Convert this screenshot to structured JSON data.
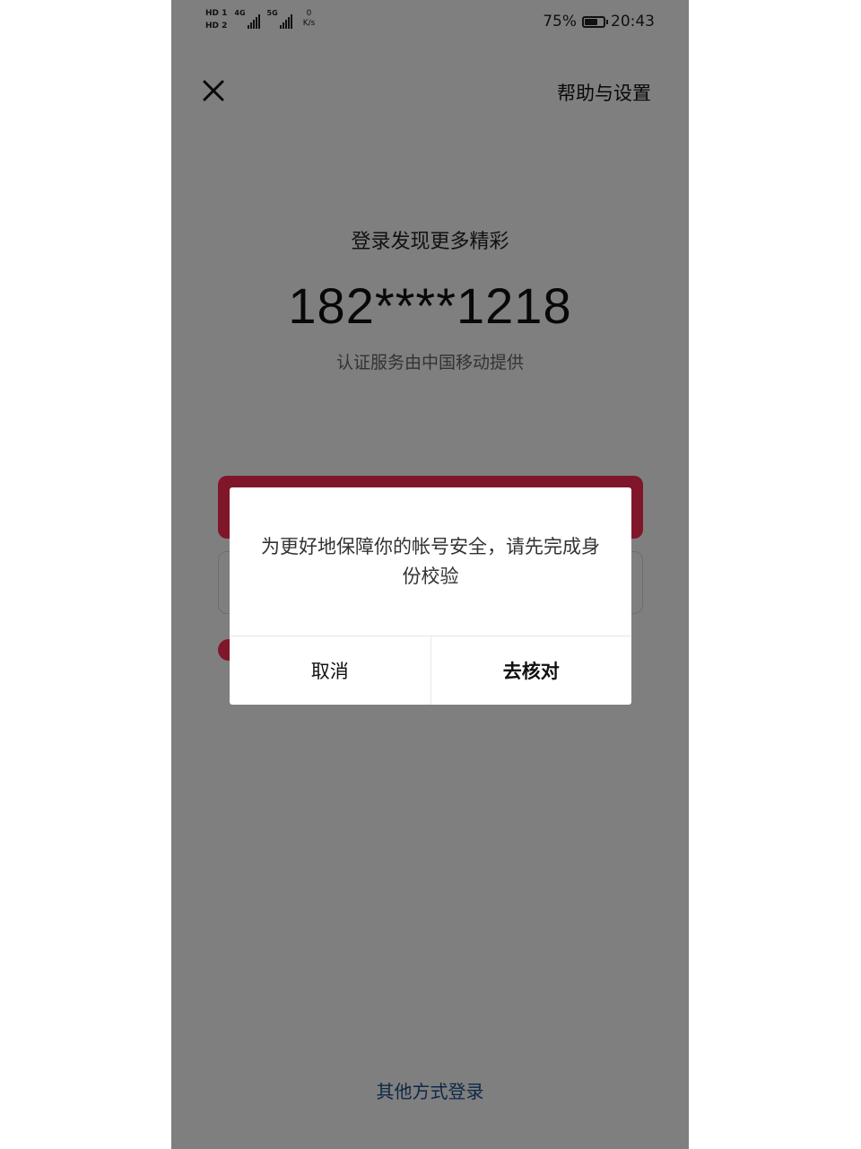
{
  "status_bar": {
    "sim1": "HD 1",
    "sim2": "HD 2",
    "net1": "4G",
    "net2": "5G",
    "speed_value": "0",
    "speed_unit": "K/s",
    "battery": "75%",
    "battery_level": 0.75,
    "time": "20:43"
  },
  "header": {
    "close_icon": "close-icon",
    "help_label": "帮助与设置"
  },
  "login": {
    "subtitle": "登录发现更多精彩",
    "phone_masked": "182****1218",
    "provider_note": "认证服务由中国移动提供",
    "other_method": "其他方式登录"
  },
  "dialog": {
    "message": "为更好地保障你的帐号安全，请先完成身份校验",
    "cancel_label": "取消",
    "confirm_label": "去核对"
  },
  "colors": {
    "accent": "#fe2c55",
    "link": "#1d4f8f",
    "overlay": "rgba(0,0,0,0.5)"
  }
}
